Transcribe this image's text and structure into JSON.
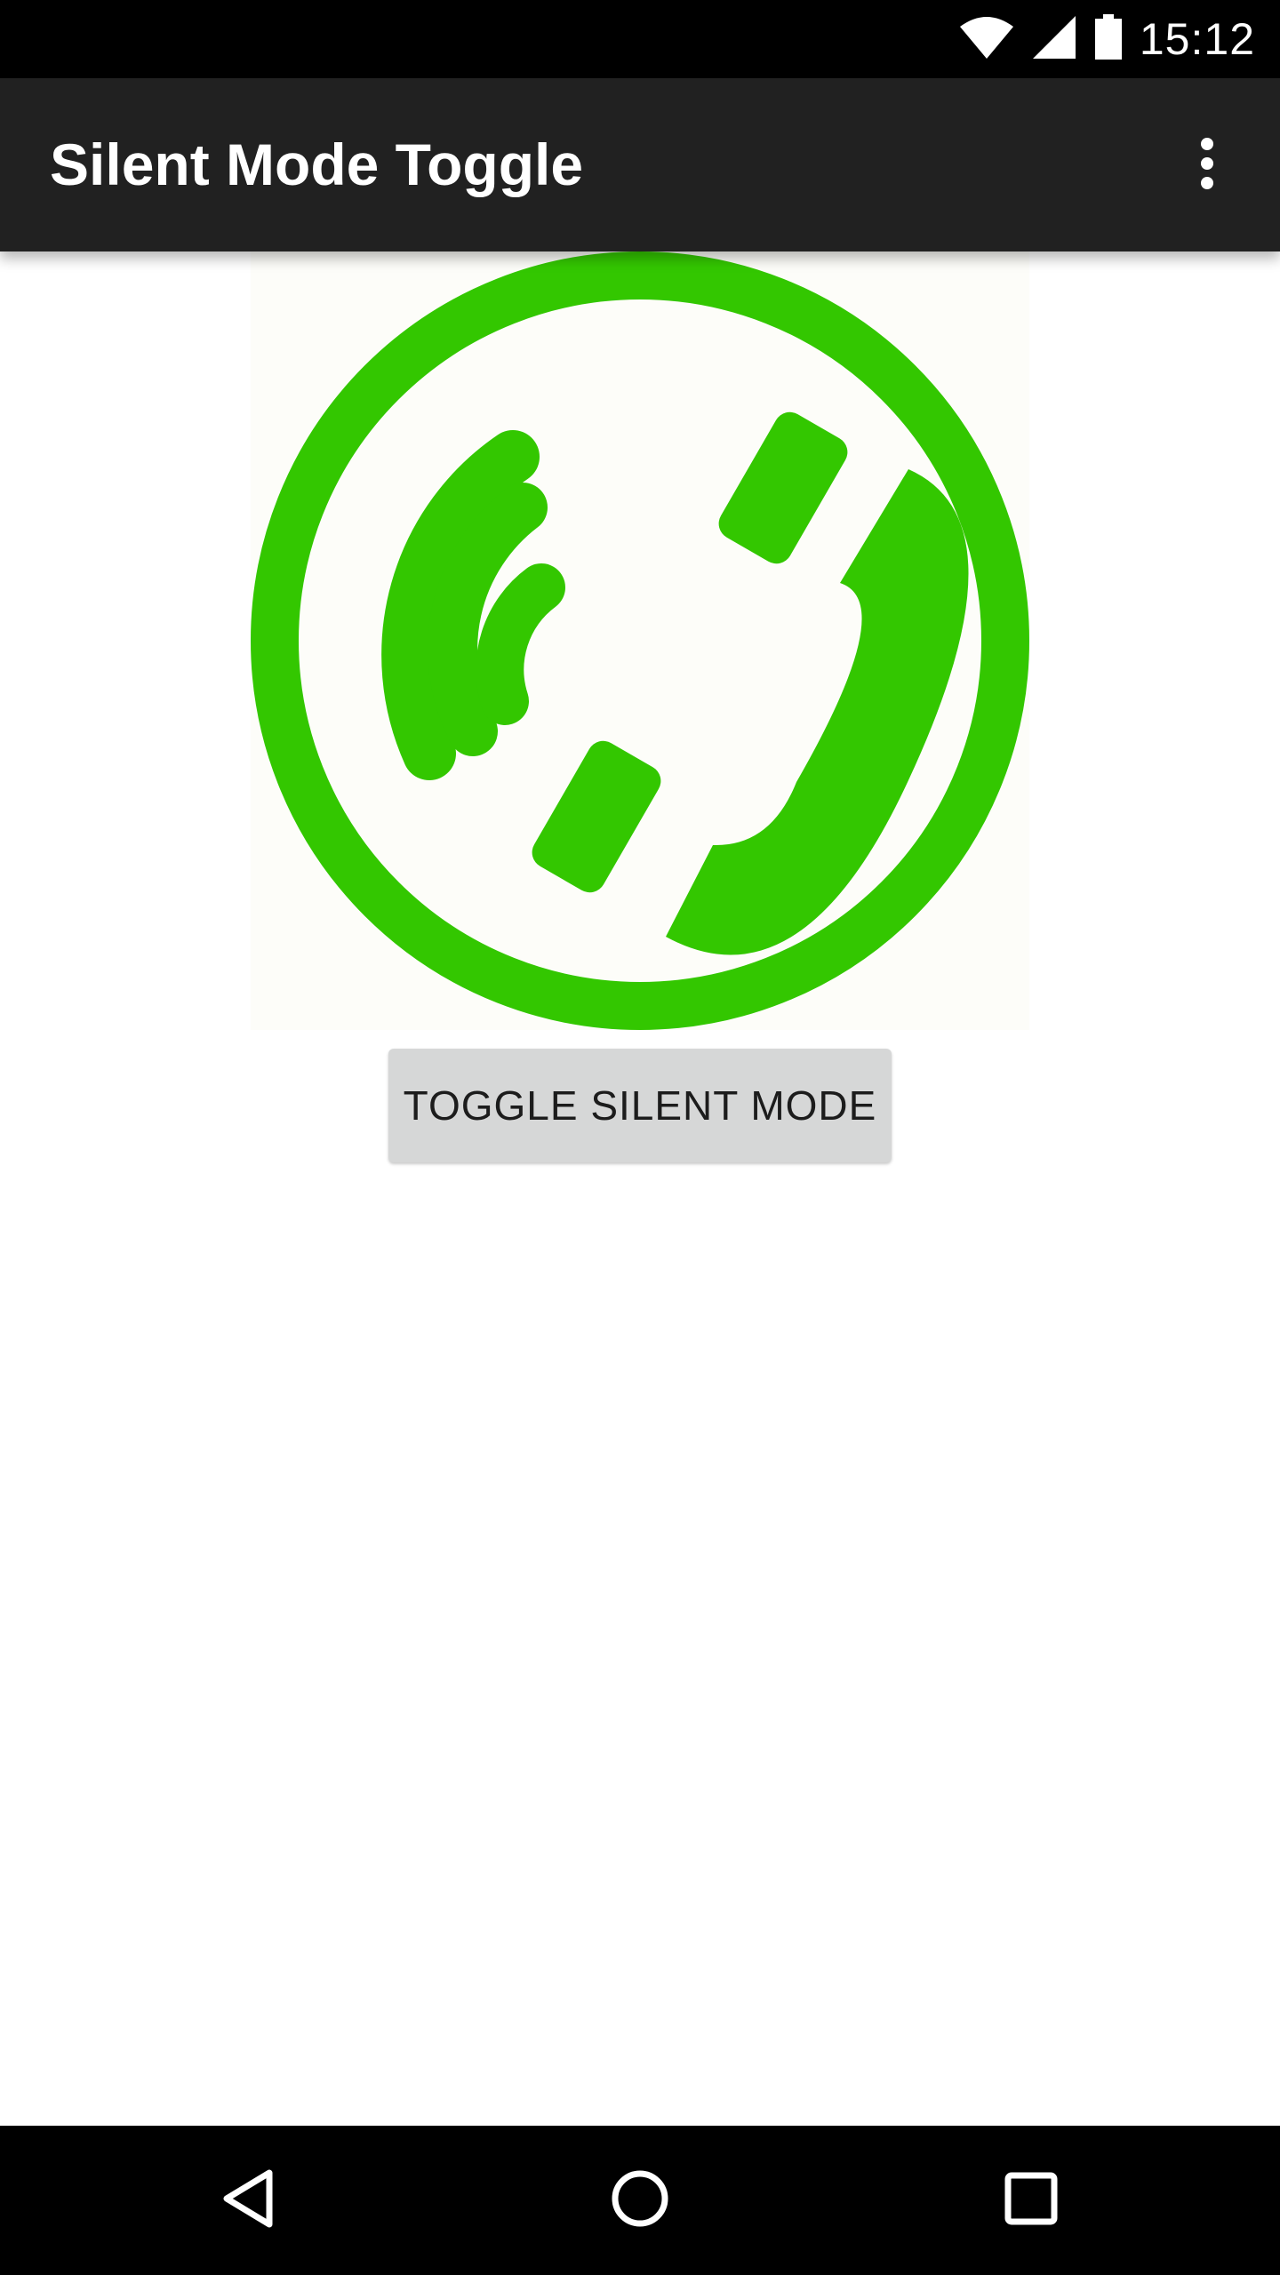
{
  "status_bar": {
    "time": "15:12",
    "icons": [
      "wifi-icon",
      "cell-signal-icon",
      "battery-icon"
    ]
  },
  "app_bar": {
    "title": "Silent Mode Toggle",
    "menu_icon": "more-vert-icon"
  },
  "main": {
    "image_icon": "phone-ringing-icon",
    "toggle_button_label": "TOGGLE SILENT MODE"
  },
  "nav_bar": {
    "icons": [
      "back-icon",
      "home-icon",
      "recents-icon"
    ]
  },
  "colors": {
    "accent_green": "#33c700",
    "app_bar": "#212121",
    "status_bar": "#000000",
    "button_bg": "#d6d7d7"
  }
}
